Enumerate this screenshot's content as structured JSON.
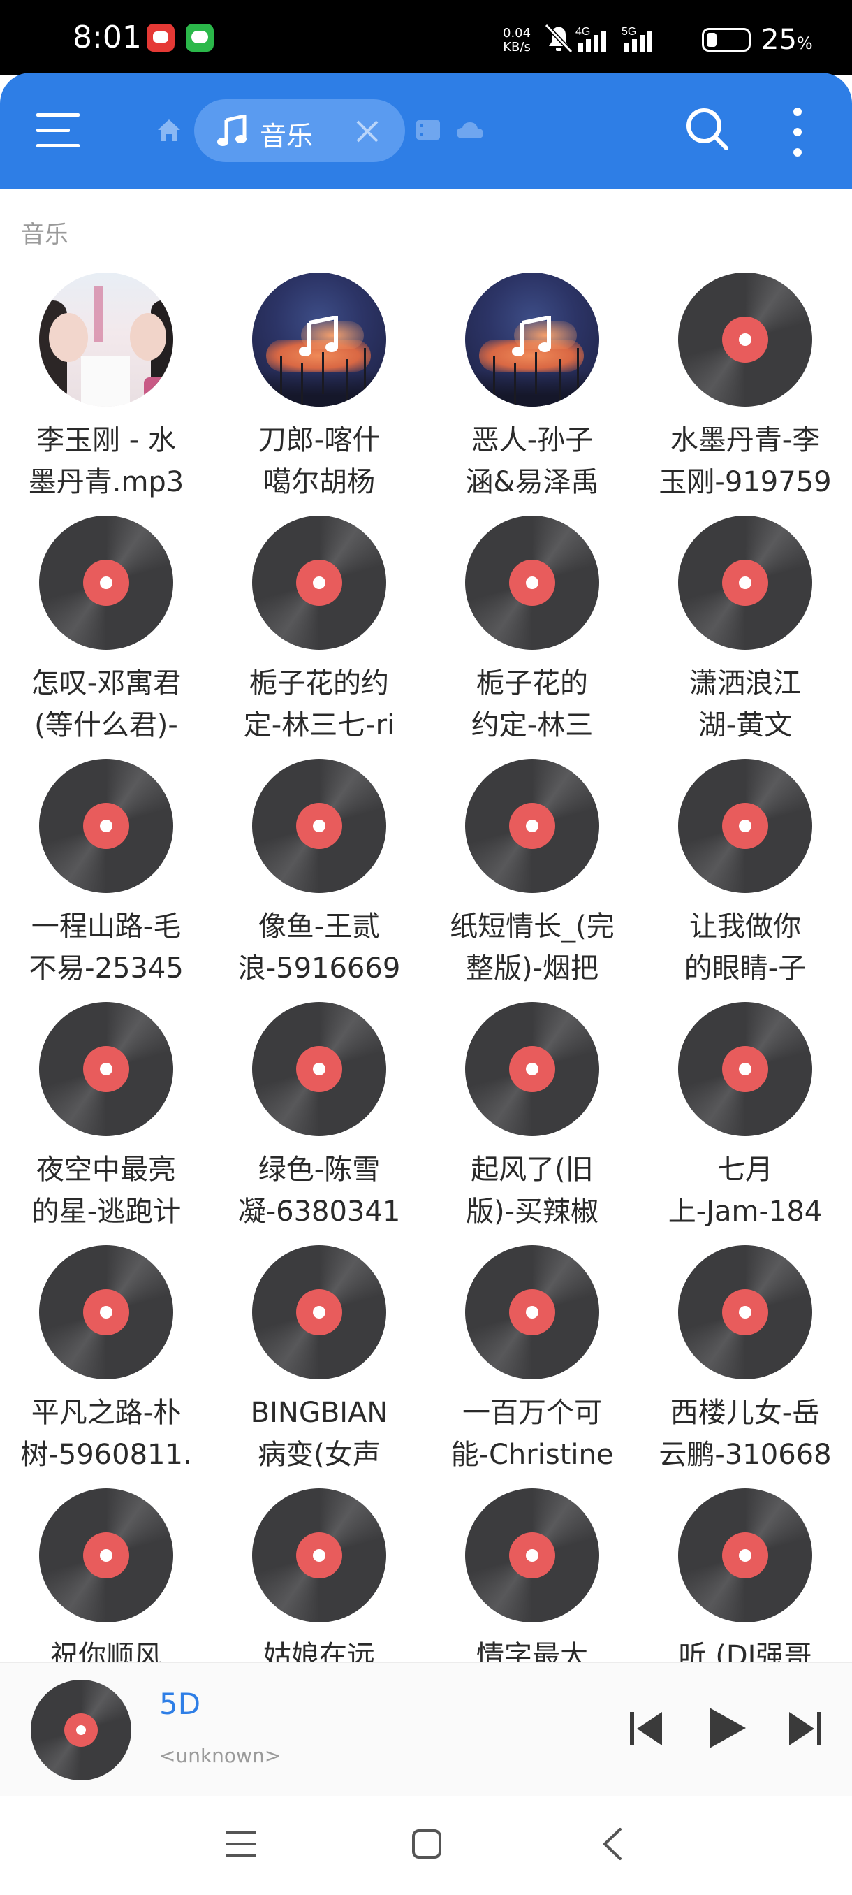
{
  "status_bar": {
    "time": "8:01",
    "net_speed_value": "0.04",
    "net_speed_unit": "KB/s",
    "network_4g": "4G",
    "network_5g": "5G",
    "battery_percent": "25",
    "battery_unit": "%",
    "battery_level": 0.25,
    "app_icons": [
      "notification-app-icon",
      "wechat-icon"
    ]
  },
  "header": {
    "tab_label": "音乐",
    "accent_color": "#2e7ee6",
    "breadcrumb_icons": [
      "home-icon",
      "music-note-icon",
      "video-icon",
      "cloud-icon"
    ]
  },
  "section": {
    "title": "音乐"
  },
  "items": [
    {
      "label": "李玉刚 - 水\n墨丹青.mp3",
      "cover": "photo"
    },
    {
      "label": "刀郎-喀什\n噶尔胡杨",
      "cover": "note"
    },
    {
      "label": "恶人-孙子\n涵&易泽禹",
      "cover": "note"
    },
    {
      "label": "水墨丹青-李\n玉刚-919759",
      "cover": "disc"
    },
    {
      "label": "怎叹-邓寓君\n(等什么君)-",
      "cover": "disc"
    },
    {
      "label": "栀子花的约\n定-林三七-ri",
      "cover": "disc"
    },
    {
      "label": "栀子花的\n约定-林三",
      "cover": "disc"
    },
    {
      "label": "潇洒浪江\n湖-黄文",
      "cover": "disc"
    },
    {
      "label": "一程山路-毛\n不易-25345",
      "cover": "disc"
    },
    {
      "label": "像鱼-王贰\n浪-5916669",
      "cover": "disc"
    },
    {
      "label": "纸短情长_(完\n整版)-烟把",
      "cover": "disc"
    },
    {
      "label": "让我做你\n的眼睛-子",
      "cover": "disc"
    },
    {
      "label": "夜空中最亮\n的星-逃跑计",
      "cover": "disc"
    },
    {
      "label": "绿色-陈雪\n凝-6380341",
      "cover": "disc"
    },
    {
      "label": "起风了(旧\n版)-买辣椒",
      "cover": "disc"
    },
    {
      "label": "七月\n上-Jam-184",
      "cover": "disc"
    },
    {
      "label": "平凡之路-朴\n树-5960811.",
      "cover": "disc"
    },
    {
      "label": "BINGBIAN\n病变(女声",
      "cover": "disc"
    },
    {
      "label": "一百万个可\n能-Christine",
      "cover": "disc"
    },
    {
      "label": "西楼儿女-岳\n云鹏-310668",
      "cover": "disc"
    },
    {
      "label": "祝你顺风",
      "cover": "disc"
    },
    {
      "label": "姑娘在远",
      "cover": "disc"
    },
    {
      "label": "情字最大",
      "cover": "disc"
    },
    {
      "label": "听 (DJ强哥",
      "cover": "disc"
    }
  ],
  "player": {
    "title": "5D",
    "artist": "<unknown>"
  },
  "nav": {
    "icons": [
      "menu-icon",
      "home-square-icon",
      "back-icon"
    ]
  }
}
